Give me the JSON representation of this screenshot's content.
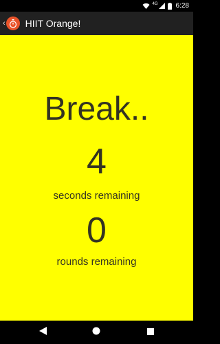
{
  "status_bar": {
    "network_label": "4G",
    "time": "6:28",
    "icons": [
      "wifi-icon",
      "cell-signal-icon",
      "battery-icon"
    ]
  },
  "app_bar": {
    "title": "HIIT Orange!",
    "icon": "stopwatch-icon"
  },
  "timer": {
    "phase": "Break..",
    "seconds_value": "4",
    "seconds_label": "seconds remaining",
    "rounds_value": "0",
    "rounds_label": "rounds remaining"
  },
  "colors": {
    "background": "#ffff00",
    "app_bar": "#212121",
    "app_icon": "#e8532a",
    "text": "#333322"
  },
  "nav_bar": {
    "icons": [
      "back-triangle-icon",
      "home-circle-icon",
      "recents-square-icon"
    ]
  }
}
